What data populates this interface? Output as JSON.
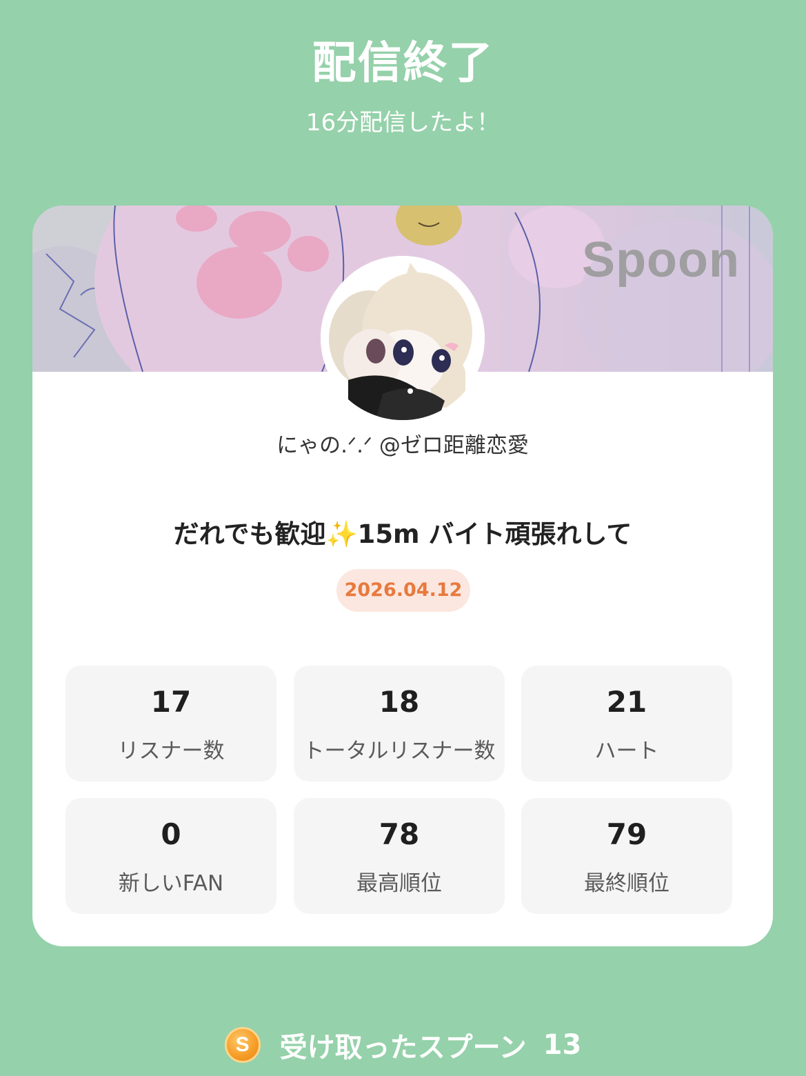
{
  "header": {
    "title": "配信終了",
    "subtitle": "16分配信したよ！"
  },
  "card": {
    "brand_watermark": "Spoon",
    "username": "にゃの.ᐟ.ᐟ @ゼロ距離恋愛",
    "live_title": "だれでも歓迎✨15m バイト頑張れして",
    "date": "2026.04.12",
    "stats": [
      {
        "value": "17",
        "label": "リスナー数"
      },
      {
        "value": "18",
        "label": "トータルリスナー数"
      },
      {
        "value": "21",
        "label": "ハート"
      },
      {
        "value": "0",
        "label": "新しいFAN"
      },
      {
        "value": "78",
        "label": "最高順位"
      },
      {
        "value": "79",
        "label": "最終順位"
      }
    ]
  },
  "footer": {
    "coin_letter": "S",
    "received_label": "受け取ったスプーン",
    "received_count": "13"
  },
  "colors": {
    "background": "#95d1aa",
    "date_text": "#e8793e",
    "date_badge": "#fbe7df",
    "coin": "#f59b24"
  }
}
